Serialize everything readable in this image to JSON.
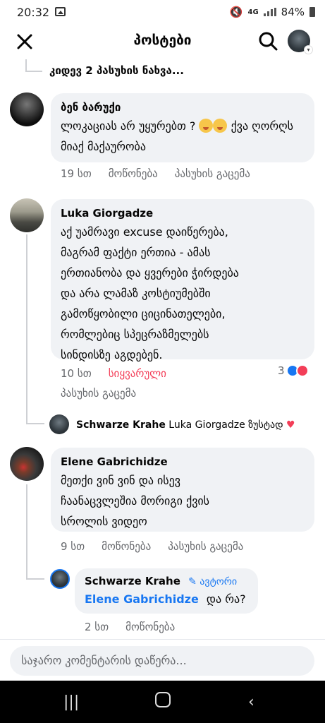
{
  "status": {
    "time": "20:32",
    "network": "4G",
    "battery": "84%"
  },
  "header": {
    "title": "პოსტები"
  },
  "more_replies": "კიდევ 2 პასუხის ნახვა...",
  "comments": [
    {
      "name": "ბენ ბარუქი",
      "text": "ლოკაციას არ უყურებთ ?",
      "text2": "ქვა ღორღს მიაქ მაქაურობა",
      "time": "19 სთ",
      "like": "მოწონება",
      "reply": "პასუხის გაცემა"
    },
    {
      "name": "Luka Giorgadze",
      "lines": [
        "აქ უამრავი excuse დაიწერება,",
        "მაგრამ ფაქტი ერთია - ამას",
        "ერთიანობა და ყვერები ჭირდება",
        "და არა ლამაზ კოსტიუმებში",
        "გამოწყობილი ციცინათელები,",
        "რომლებიც სპეცრაზმელებს",
        "სინდისზე აგდებენ."
      ],
      "time": "10 სთ",
      "reaction_label": "სიყვარული",
      "reaction_count": "3",
      "reply": "პასუხის გაცემა"
    },
    {
      "name": "Elene Gabrichidze",
      "lines": [
        "მეთქი ვინ ვინ და ისევ",
        "ჩაანაცვლეშია მორიგი ქვის",
        "სროლის ვიდეო"
      ],
      "time": "9 სთ",
      "like": "მოწონება",
      "reply": "პასუხის გაცემა"
    }
  ],
  "reply_preview": {
    "name": "Schwarze Krahe",
    "text": "Luka Giorgadze ზუსტად"
  },
  "author_reply": {
    "name": "Schwarze Krahe",
    "badge": "ავტორი",
    "mention": "Elene Gabrichidze",
    "text": "და რა?",
    "time": "2 სთ",
    "like": "მოწონება"
  },
  "composer": {
    "placeholder": "საჯარო კომენტარის დაწერა..."
  }
}
